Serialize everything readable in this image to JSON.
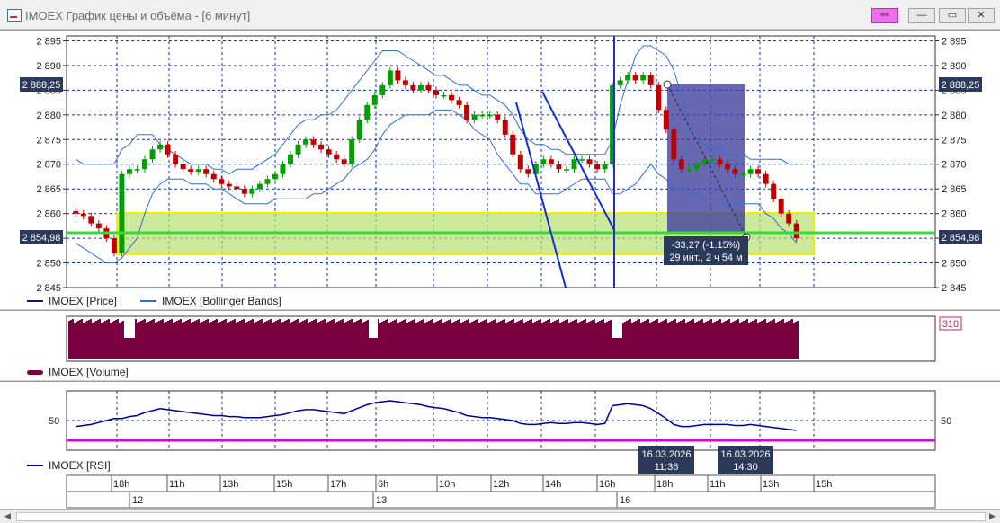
{
  "window": {
    "title": "IMOEX График цены и объёма - [6 минут]",
    "buttons": {
      "link": "⚯",
      "minimize": "—",
      "maximize": "▭",
      "close": "✕"
    }
  },
  "colors": {
    "bull": "#00a000",
    "bear": "#c00000",
    "bollinger": "#3070d0",
    "volume": "#7a0040",
    "rsi": "#0000a0",
    "rsi_level": "#e000e0",
    "zone_fill": "#b8e070",
    "zone_border": "#f0f000",
    "measure_fill": "#3c3c9c",
    "current_line": "#30e030"
  },
  "price_panel": {
    "legend_price": "IMOEX [Price]",
    "legend_bb": "IMOEX [Bollinger Bands]",
    "current_price_label": "2 854,98",
    "crosshair_price_label": "2 888,25",
    "measure_label_line1": "-33,27 (-1.15%)",
    "measure_label_line2": "29 инт., 2 ч 54 м"
  },
  "volume_panel": {
    "legend": "IMOEX [Volume]",
    "value_label": "310"
  },
  "rsi_panel": {
    "legend": "IMOEX [RSI]",
    "level_label": "50",
    "level_label_right": "50",
    "cursor1_date": "16.03.2026",
    "cursor1_time": "11:36",
    "cursor2_date": "16.03.2026",
    "cursor2_time": "14:30"
  },
  "time_axis": {
    "hours": [
      "18h",
      "11h",
      "13h",
      "15h",
      "17h",
      "6h",
      "10h",
      "12h",
      "14h",
      "16h",
      "18h",
      "11h",
      "13h",
      "15h"
    ],
    "days": [
      "12",
      "13",
      "16"
    ]
  },
  "chart_data": {
    "type": "candlestick",
    "title": "IMOEX График цены и объёма - [6 минут]",
    "y_axis": {
      "ticks": [
        "2 895",
        "2 890",
        "2 885",
        "2 880",
        "2 875",
        "2 870",
        "2 865",
        "2 860",
        "2 855",
        "2 850",
        "2 845"
      ],
      "range": [
        2845,
        2896
      ]
    },
    "series": [
      {
        "name": "IMOEX [Price]",
        "close": [
          2860,
          2859.5,
          2858,
          2857,
          2855,
          2852,
          2868,
          2869,
          2869,
          2871,
          2873,
          2874,
          2872,
          2870,
          2869,
          2868.5,
          2869,
          2868,
          2867,
          2866,
          2865.5,
          2865,
          2864,
          2865,
          2866,
          2867,
          2868,
          2870,
          2872,
          2874,
          2875,
          2874,
          2873,
          2872,
          2871,
          2870,
          2875,
          2879,
          2882,
          2884,
          2886,
          2889,
          2887,
          2886,
          2885,
          2886,
          2885,
          2884,
          2884,
          2883,
          2882,
          2879,
          2880,
          2880,
          2880,
          2879,
          2876,
          2872,
          2869,
          2868,
          2870,
          2871,
          2870,
          2869,
          2869,
          2871,
          2871,
          2870,
          2869,
          2870,
          2886,
          2887,
          2888,
          2887,
          2888,
          2886,
          2881,
          2877,
          2871,
          2869,
          2869,
          2870,
          2871,
          2871,
          2870,
          2869,
          2868,
          2868,
          2869,
          2868,
          2866,
          2863,
          2860,
          2858,
          2855
        ]
      },
      {
        "name": "IMOEX [Bollinger Bands]",
        "upper": [
          2871,
          2870,
          2870,
          2870,
          2870,
          2870,
          2873,
          2874,
          2876,
          2876,
          2876,
          2874,
          2873,
          2872,
          2871,
          2870,
          2870,
          2870,
          2869,
          2869,
          2868,
          2869,
          2869,
          2869,
          2870,
          2871,
          2872,
          2874,
          2876,
          2878,
          2879,
          2879,
          2880,
          2880,
          2881,
          2883,
          2885,
          2887,
          2889,
          2891,
          2893,
          2893,
          2893,
          2892,
          2891,
          2890,
          2889,
          2888,
          2888,
          2887,
          2886,
          2886,
          2885,
          2884,
          2884,
          2883,
          2882,
          2880,
          2877,
          2875,
          2874,
          2874,
          2873,
          2873,
          2872,
          2872,
          2872,
          2872,
          2872,
          2872,
          2875,
          2882,
          2887,
          2892,
          2894,
          2894,
          2893,
          2892,
          2889,
          2884,
          2877,
          2875,
          2874,
          2873,
          2873,
          2872,
          2872,
          2872,
          2871,
          2871,
          2871,
          2871,
          2871,
          2870,
          2870
        ],
        "lower": [
          2854,
          2853,
          2852,
          2851,
          2850,
          2850,
          2851,
          2853,
          2855,
          2860,
          2864,
          2866,
          2867,
          2867,
          2867,
          2866,
          2866,
          2866,
          2865,
          2865,
          2864,
          2863,
          2862,
          2862,
          2862,
          2862,
          2863,
          2863,
          2863,
          2863,
          2863,
          2864,
          2864,
          2865,
          2866,
          2867,
          2869,
          2870,
          2871,
          2873,
          2876,
          2878,
          2879,
          2880,
          2880,
          2880,
          2880,
          2881,
          2881,
          2881,
          2880,
          2879,
          2877,
          2876,
          2875,
          2872,
          2870,
          2868,
          2866,
          2866,
          2864,
          2864,
          2864,
          2864,
          2865,
          2866,
          2867,
          2867,
          2867,
          2867,
          2864,
          2864,
          2865,
          2866,
          2868,
          2870,
          2868,
          2867,
          2865,
          2865,
          2864,
          2864,
          2863,
          2863,
          2863,
          2862,
          2862,
          2862,
          2862,
          2862,
          2860,
          2859,
          2857,
          2856,
          2854
        ]
      },
      {
        "name": "IMOEX [Volume]",
        "note": "volume bars with value label 310"
      },
      {
        "name": "IMOEX [RSI]",
        "values": [
          44,
          45,
          46,
          48,
          50,
          52,
          52,
          54,
          55,
          58,
          60,
          62,
          61,
          60,
          59,
          58,
          57,
          56,
          55,
          55,
          54,
          54,
          53,
          53,
          53,
          54,
          55,
          56,
          58,
          60,
          61,
          61,
          60,
          59,
          58,
          57,
          60,
          63,
          66,
          68,
          69,
          70,
          69,
          68,
          67,
          66,
          64,
          63,
          62,
          60,
          58,
          55,
          54,
          53,
          53,
          52,
          51,
          50,
          47,
          46,
          46,
          47,
          48,
          47,
          47,
          48,
          48,
          47,
          46,
          47,
          65,
          66,
          67,
          66,
          65,
          62,
          57,
          52,
          46,
          44,
          44,
          45,
          46,
          46,
          46,
          46,
          45,
          45,
          46,
          45,
          44,
          43,
          42,
          41,
          40
        ]
      }
    ],
    "annotations": [
      "2 888,25",
      "2 854,98",
      "-33,27 (-1.15%)",
      "29 инт., 2 ч 54 м"
    ]
  }
}
